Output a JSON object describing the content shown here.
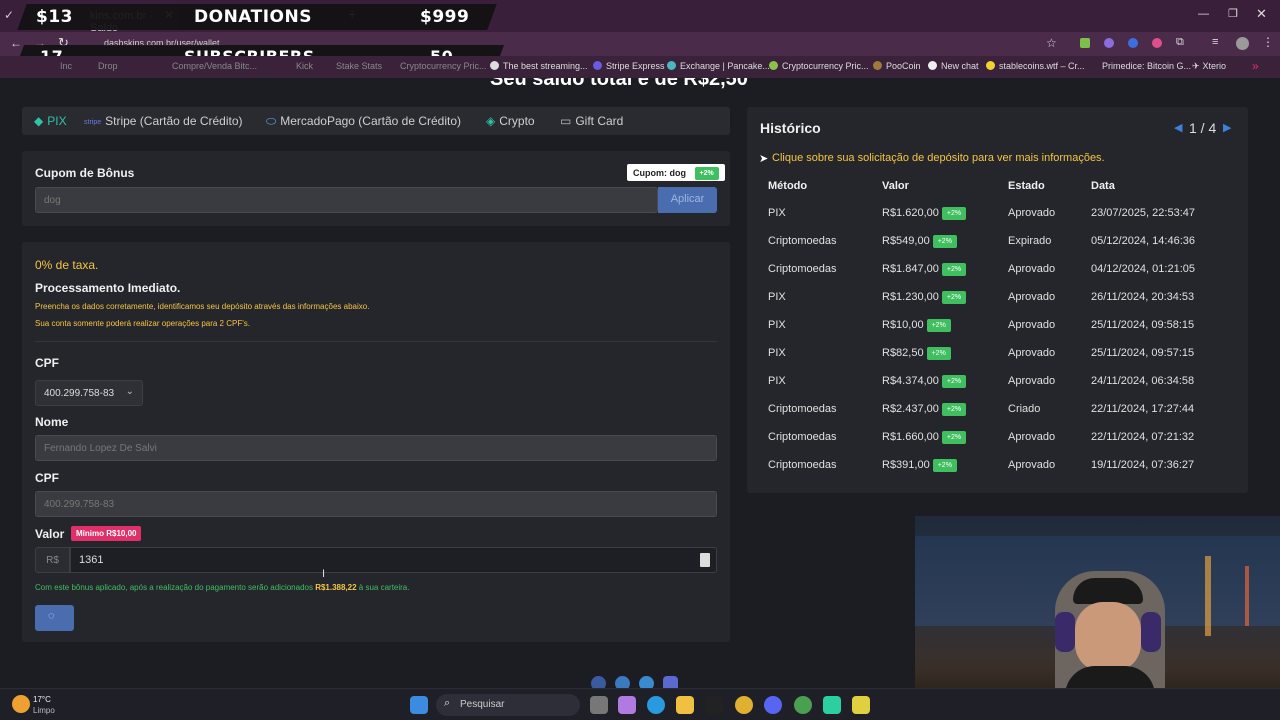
{
  "overlay": {
    "donations_amount": "$13",
    "donations_label": "DONATIONS",
    "donations_goal": "$999",
    "subscribers_count": "17",
    "subscribers_label": "SUBSCRIBERS",
    "subscribers_goal": "50"
  },
  "browser": {
    "tab_title": "kins.com.br - Saldo",
    "tab2_partial": "ho",
    "new_tab": "+",
    "url": "dashskins.com.br/user/wallet",
    "bookmarks": [
      "The best streaming...",
      "Stripe Express",
      "Exchange | Pancake...",
      "Cryptocurrency Pric...",
      "PooCoin",
      "New chat",
      "stablecoins.wtf – Cr...",
      "Primedice: Bitcoin G...",
      "Xterio"
    ],
    "bookmarks_left": [
      "Inc",
      "Drop",
      "Compre/Venda Bitc...",
      "Kick",
      "Stake Stats",
      "Cryptocurrency Pric..."
    ]
  },
  "page": {
    "heading_partial": "Seu saldo total é de R$2,50",
    "pay_tabs": [
      {
        "label": "PIX",
        "icon": "pix-icon"
      },
      {
        "label": "Stripe (Cartão de Crédito)",
        "icon": "stripe-icon"
      },
      {
        "label": "MercadoPago (Cartão de Crédito)",
        "icon": "mercadopago-icon"
      },
      {
        "label": "Crypto",
        "icon": "crypto-icon"
      },
      {
        "label": "Gift Card",
        "icon": "giftcard-icon"
      }
    ],
    "stripe_mini": "stripe",
    "coupon": {
      "title": "Cupom de Bônus",
      "badge_label": "Cupom: dog",
      "badge_pct": "+2%",
      "input_value": "dog",
      "apply_label": "Aplicar"
    },
    "form": {
      "fee": "0% de taxa.",
      "processing": "Processamento Imediato.",
      "note1": "Preencha os dados corretamente, identificamos seu depósito através das informações abaixo.",
      "note2": "Sua conta somente poderá realizar operações para 2 CPF's.",
      "cpf_label": "CPF",
      "cpf_select": "400.299.758-83",
      "name_label": "Nome",
      "name_value": "Fernando Lopez De Salvi",
      "cpf2_label": "CPF",
      "cpf2_value": "400.299.758-83",
      "valor_label": "Valor",
      "min_badge": "Mínimo R$10,00",
      "currency": "R$",
      "amount": "1361",
      "bonus_prefix": "Com este bônus aplicado, após a realização do pagamento serão adicionados ",
      "bonus_amount": "R$1.388,22",
      "bonus_suffix": " à sua carteira."
    },
    "history": {
      "title": "Histórico",
      "pager": "1 / 4",
      "hint": "Clique sobre sua solicitação de depósito para ver mais informações.",
      "headers": [
        "Método",
        "Valor",
        "Estado",
        "Data"
      ],
      "rows": [
        {
          "method": "PIX",
          "value": "R$1.620,00",
          "pct": "+2%",
          "state": "Aprovado",
          "date": "23/07/2025, 22:53:47"
        },
        {
          "method": "Criptomoedas",
          "value": "R$549,00",
          "pct": "+2%",
          "state": "Expirado",
          "date": "05/12/2024, 14:46:36"
        },
        {
          "method": "Criptomoedas",
          "value": "R$1.847,00",
          "pct": "+2%",
          "state": "Aprovado",
          "date": "04/12/2024, 01:21:05"
        },
        {
          "method": "PIX",
          "value": "R$1.230,00",
          "pct": "+2%",
          "state": "Aprovado",
          "date": "26/11/2024, 20:34:53"
        },
        {
          "method": "PIX",
          "value": "R$10,00",
          "pct": "+2%",
          "state": "Aprovado",
          "date": "25/11/2024, 09:58:15"
        },
        {
          "method": "PIX",
          "value": "R$82,50",
          "pct": "+2%",
          "state": "Aprovado",
          "date": "25/11/2024, 09:57:15"
        },
        {
          "method": "PIX",
          "value": "R$4.374,00",
          "pct": "+2%",
          "state": "Aprovado",
          "date": "24/11/2024, 06:34:58"
        },
        {
          "method": "Criptomoedas",
          "value": "R$2.437,00",
          "pct": "+2%",
          "state": "Criado",
          "date": "22/11/2024, 17:27:44"
        },
        {
          "method": "Criptomoedas",
          "value": "R$1.660,00",
          "pct": "+2%",
          "state": "Aprovado",
          "date": "22/11/2024, 07:21:32"
        },
        {
          "method": "Criptomoedas",
          "value": "R$391,00",
          "pct": "+2%",
          "state": "Aprovado",
          "date": "19/11/2024, 07:36:27"
        }
      ]
    }
  },
  "taskbar": {
    "temp": "17°C",
    "weather": "Limpo",
    "search_placeholder": "Pesquisar"
  },
  "colors": {
    "accent_teal": "#2fc3a8",
    "yellow": "#f5c542",
    "green": "#3fbf5f",
    "pink": "#e0306a",
    "button_blue": "#4a6db0"
  }
}
